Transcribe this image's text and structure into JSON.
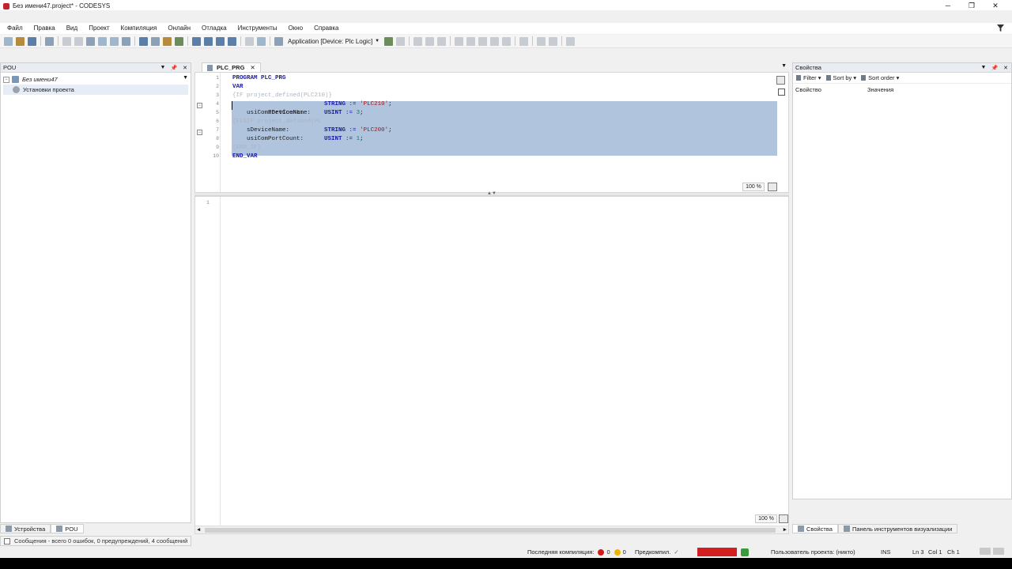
{
  "window": {
    "title": "Без имени47.project* - CODESYS",
    "min": "─",
    "max": "❐",
    "close": "✕"
  },
  "menu": [
    "Файл",
    "Правка",
    "Вид",
    "Проект",
    "Компиляция",
    "Онлайн",
    "Отладка",
    "Инструменты",
    "Окно",
    "Справка"
  ],
  "toolbar": {
    "application": "Application [Device: Plc Logic]"
  },
  "pou_panel": {
    "title": "POU",
    "tree": [
      {
        "label": "Без имени47",
        "italic": true
      },
      {
        "label": "Установки проекта"
      }
    ],
    "tabs": [
      "Устройства",
      "POU"
    ]
  },
  "editor": {
    "tab": "PLC_PRG",
    "declaration_lines": [
      "PROGRAM PLC_PRG",
      "VAR",
      "{IF project_defined(PLC210)}",
      "sDeviceName:",
      "usiComPortCount:",
      "{ELSIF project_defined(PL",
      "sDeviceName:",
      "usiComPortCount:",
      "{END_IF}",
      "END_VAR"
    ],
    "var_types": {
      "l4_type": "STRING",
      "l4_op": ":=",
      "l4_val": "'PLC210'",
      "l5_type": "USINT",
      "l5_op": ":=",
      "l5_val": "3",
      "l7_type": "STRING",
      "l7_op": ":=",
      "l7_val": "'PLC200'",
      "l8_type": "USINT",
      "l8_op": ":=",
      "l8_val": "1"
    },
    "line_numbers": [
      "1",
      "2",
      "3",
      "4",
      "5",
      "6",
      "7",
      "8",
      "9",
      "10"
    ],
    "impl_line": "1",
    "zoom_decl": "100 %",
    "zoom_impl": "100 %"
  },
  "properties": {
    "title": "Свойства",
    "filter": "Filter",
    "sort_by": "Sort by",
    "sort_order": "Sort order",
    "col_property": "Свойство",
    "col_value": "Значения",
    "tabs": [
      "Свойства",
      "Панель инструментов визуализации"
    ]
  },
  "messages": "Сообщения - всего 0 ошибок, 0 предупреждений, 4 сообщений",
  "status": {
    "last_compile": "Последняя компиляция:",
    "errors": "0",
    "warnings": "0",
    "precompile": "Предкомпил.",
    "user": "Пользователь проекта: (никто)",
    "ins": "INS",
    "ln": "Ln 3",
    "col": "Col 1",
    "ch": "Ch 1"
  }
}
